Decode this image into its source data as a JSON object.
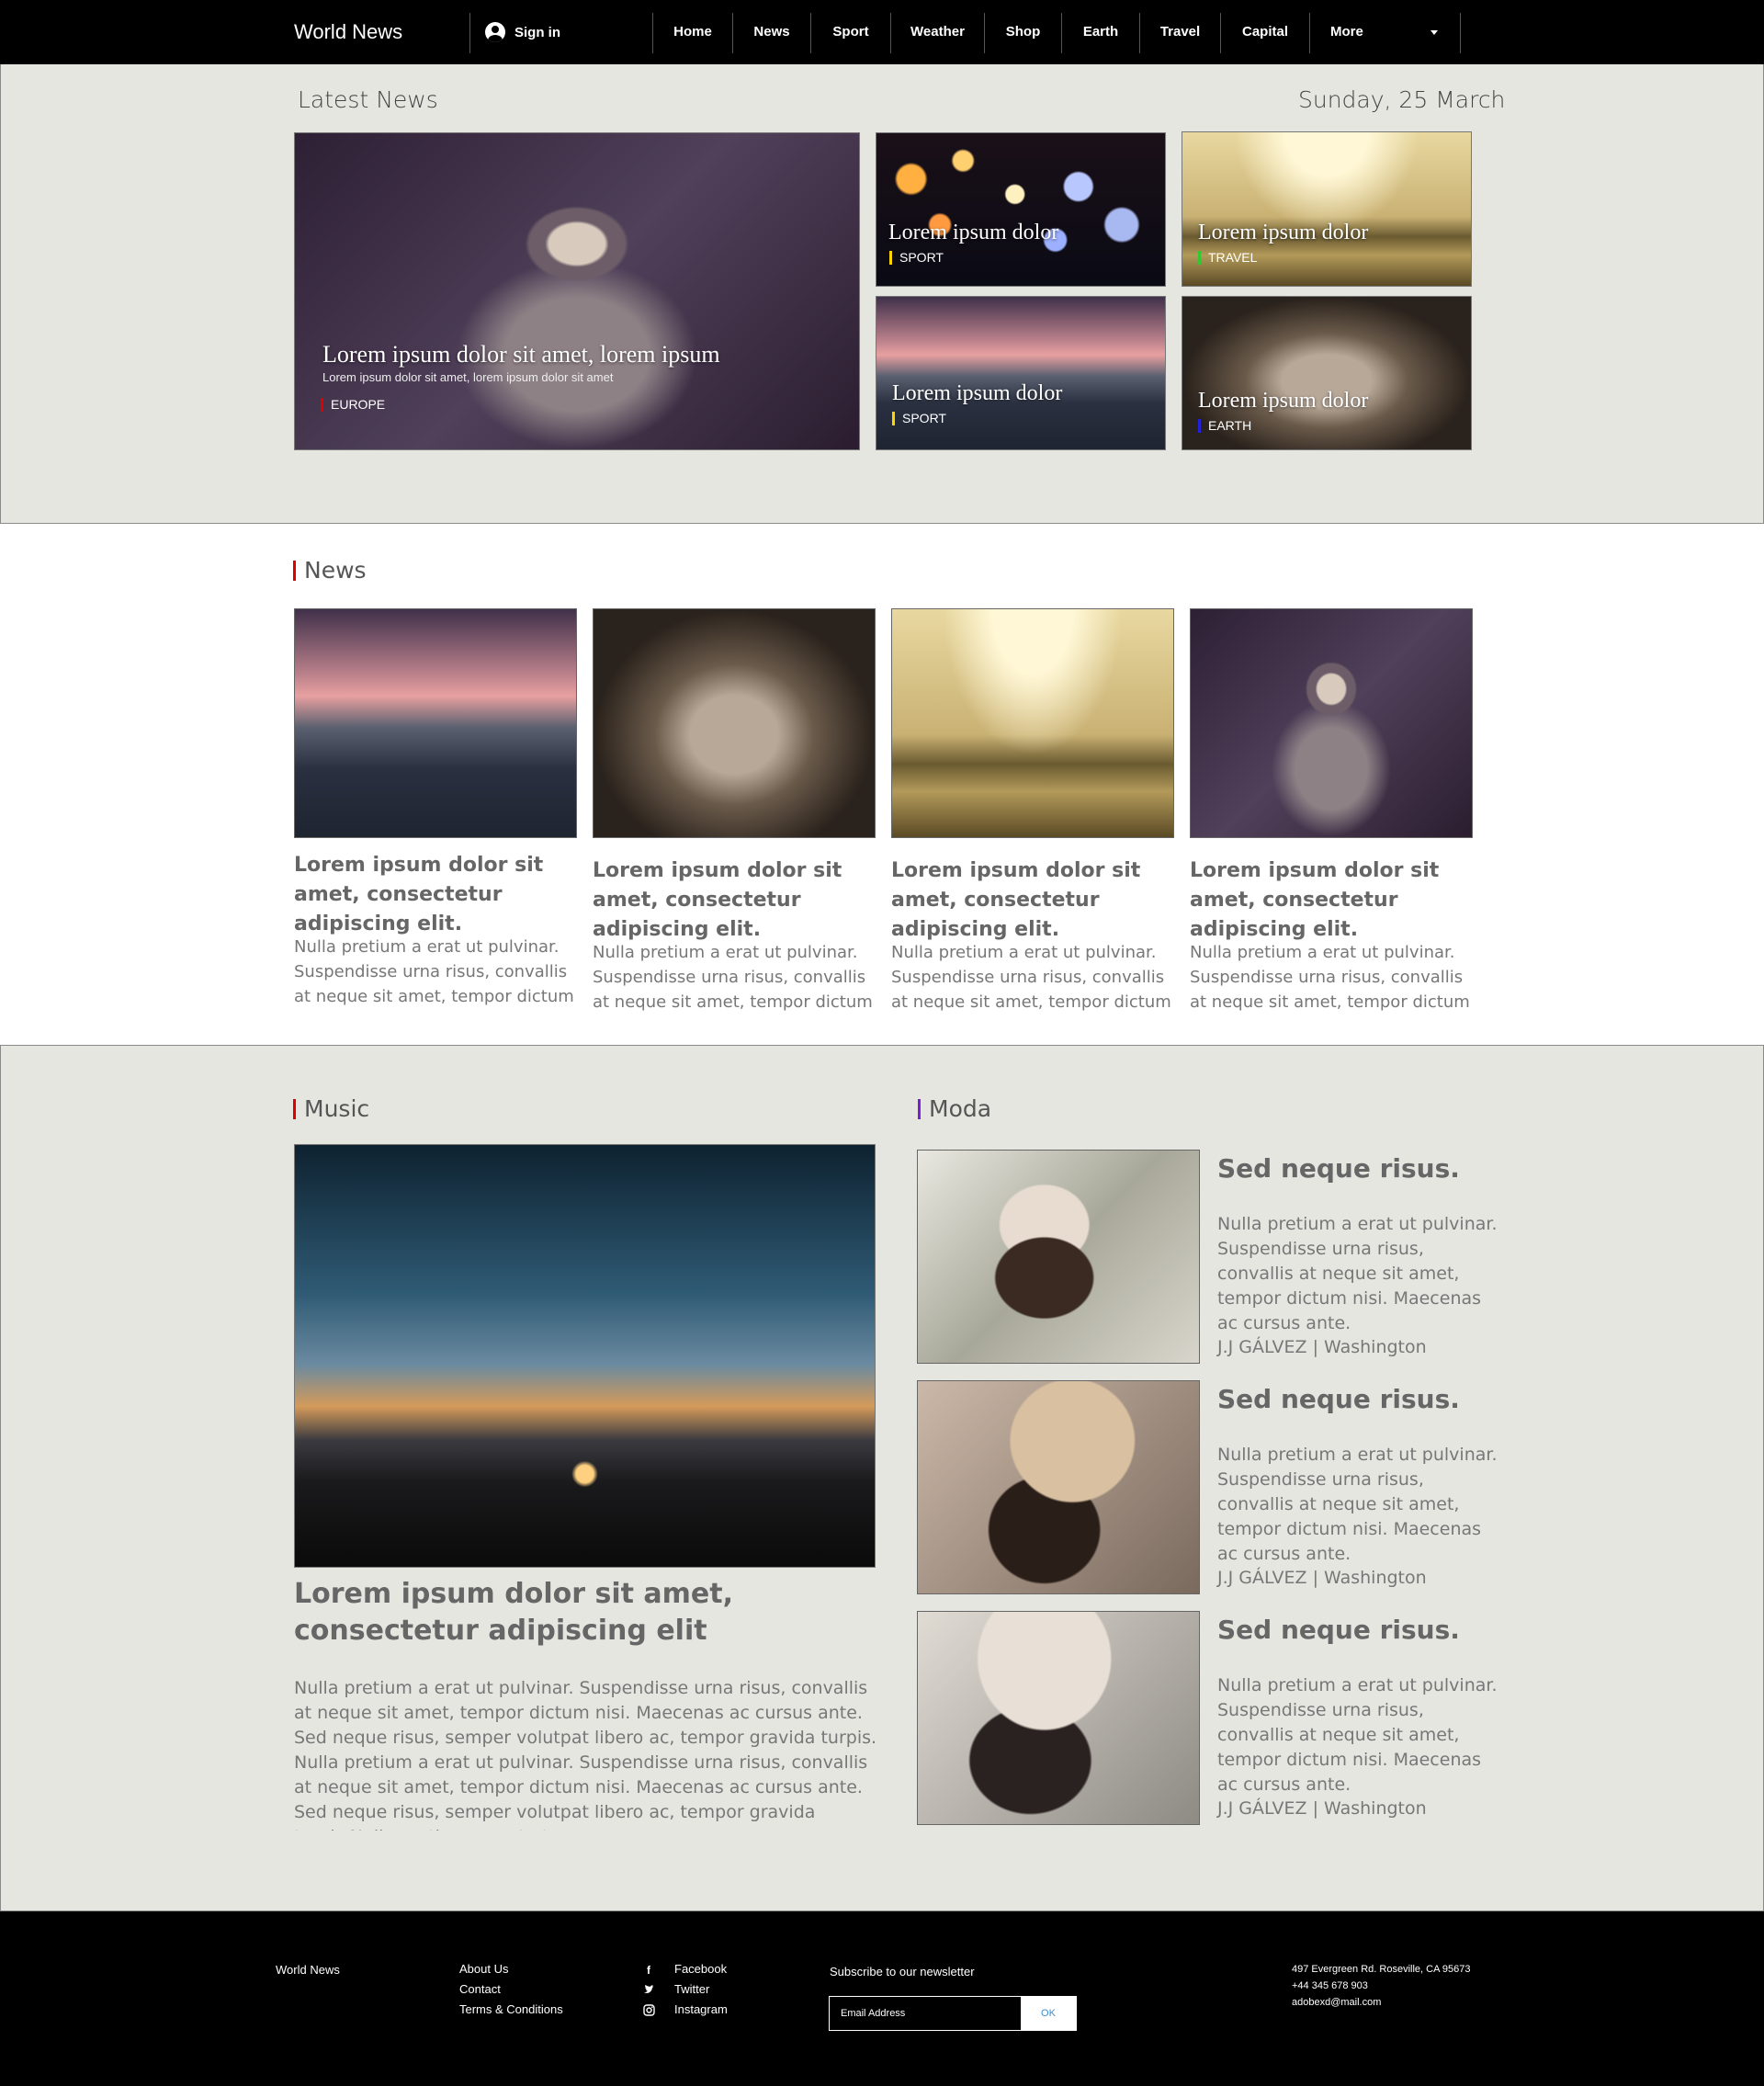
{
  "nav": {
    "brand": "World News",
    "sign_in": "Sign in",
    "items": [
      "Home",
      "News",
      "Sport",
      "Weather",
      "Shop",
      "Earth",
      "Travel",
      "Capital",
      "More"
    ]
  },
  "latest": {
    "title": "Latest News",
    "date": "Sunday, 25 March",
    "feature": {
      "headline": "Lorem ipsum dolor sit amet, lorem ipsum",
      "subline": "Lorem ipsum dolor sit amet, lorem ipsum dolor sit amet",
      "tag": "EUROPE",
      "tag_color": "#e00000"
    },
    "tiles": [
      {
        "headline": "Lorem ipsum dolor",
        "tag": "SPORT",
        "tag_color": "#ffd400"
      },
      {
        "headline": "Lorem ipsum dolor",
        "tag": "TRAVEL",
        "tag_color": "#32c832"
      },
      {
        "headline": "Lorem ipsum dolor",
        "tag": "SPORT",
        "tag_color": "#ffd400"
      },
      {
        "headline": "Lorem ipsum dolor",
        "tag": "EARTH",
        "tag_color": "#2222dd"
      }
    ]
  },
  "news": {
    "title": "News",
    "bar_color": "#e00000",
    "cards": [
      {
        "headline": "Lorem ipsum dolor sit amet, consectetur adipiscing elit.",
        "body": "Nulla pretium a erat ut pulvinar. Suspendisse urna risus, convallis at neque sit amet, tempor dictum"
      },
      {
        "headline": "Lorem ipsum dolor sit amet, consectetur adipiscing elit.",
        "body": "Nulla pretium a erat ut pulvinar. Suspendisse urna risus, convallis at neque sit amet, tempor dictum"
      },
      {
        "headline": "Lorem ipsum dolor sit amet, consectetur adipiscing elit.",
        "body": "Nulla pretium a erat ut pulvinar. Suspendisse urna risus, convallis at neque sit amet, tempor dictum"
      },
      {
        "headline": "Lorem ipsum dolor sit amet, consectetur adipiscing elit.",
        "body": "Nulla pretium a erat ut pulvinar. Suspendisse urna risus, convallis at neque sit amet, tempor dictum"
      }
    ]
  },
  "music": {
    "title": "Music",
    "bar_color": "#e00000",
    "headline": "Lorem ipsum dolor sit amet, consectetur adipiscing elit",
    "body": "Nulla pretium a erat ut pulvinar. Suspendisse urna risus, convallis at neque sit amet, tempor dictum nisi. Maecenas ac cursus ante. Sed neque risus, semper volutpat libero ac, tempor gravida turpis. Nulla pretium a erat ut pulvinar. Suspendisse urna risus, convallis at neque sit amet, tempor dictum nisi. Maecenas ac cursus ante. Sed neque risus, semper volutpat libero ac, tempor gravida turpis.Nulla pretium a erat ut"
  },
  "moda": {
    "title": "Moda",
    "bar_color": "#7a1fd6",
    "items": [
      {
        "headline": "Sed neque risus.",
        "body": "Nulla pretium a erat ut pulvinar. Suspendisse urna risus, convallis at neque sit amet, tempor dictum nisi. Maecenas ac cursus ante.",
        "byline": "J.J GÁLVEZ | Washington"
      },
      {
        "headline": "Sed neque risus.",
        "body": "Nulla pretium a erat ut pulvinar. Suspendisse urna risus, convallis at neque sit amet, tempor dictum nisi. Maecenas ac cursus ante.",
        "byline": "J.J GÁLVEZ | Washington"
      },
      {
        "headline": "Sed neque risus.",
        "body": "Nulla pretium a erat ut pulvinar. Suspendisse urna risus, convallis at neque sit amet, tempor dictum nisi. Maecenas ac cursus ante.",
        "byline": "J.J GÁLVEZ | Washington"
      }
    ]
  },
  "footer": {
    "brand": "World News",
    "links": [
      "About Us",
      "Contact",
      "Terms & Conditions"
    ],
    "social": [
      {
        "label": "Facebook",
        "icon": "facebook-icon"
      },
      {
        "label": "Twitter",
        "icon": "twitter-icon"
      },
      {
        "label": "Instagram",
        "icon": "instagram-icon"
      }
    ],
    "newsletter_title": "Subscribe to our newsletter",
    "email_placeholder": "Email Address",
    "ok_label": "OK",
    "address": [
      "497 Evergreen Rd. Roseville, CA 95673",
      "+44 345 678 903",
      "adobexd@mail.com"
    ]
  }
}
